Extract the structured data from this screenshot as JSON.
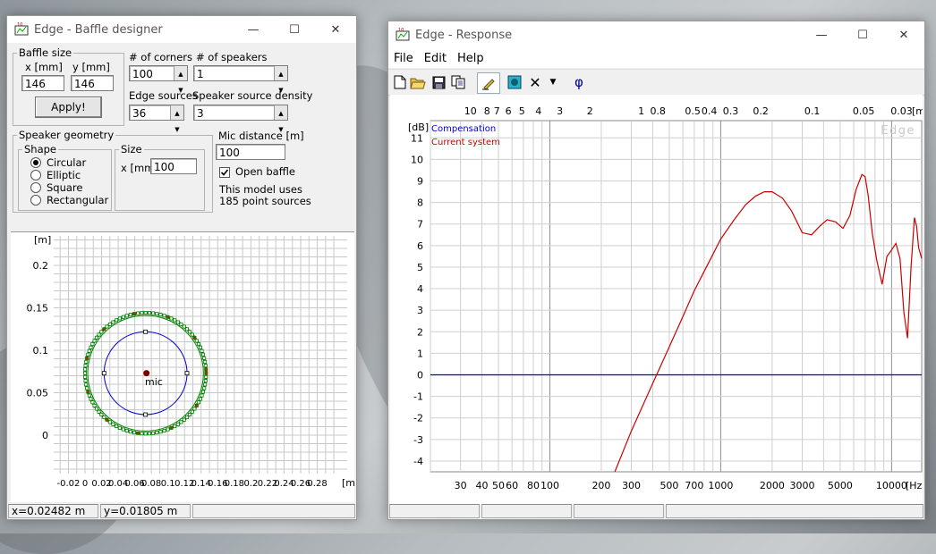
{
  "baffle_window": {
    "title": "Edge - Baffle designer",
    "controls": {
      "minimize": "—",
      "maximize": "☐",
      "close": "✕"
    },
    "baffle_size": {
      "group_label": "Baffle size",
      "x_label": "x [mm]",
      "y_label": "y [mm]",
      "x_value": "146",
      "y_value": "146",
      "apply_label": "Apply!"
    },
    "corners": {
      "label": "# of corners",
      "value": "100"
    },
    "speakers": {
      "label": "# of speakers",
      "value": "1"
    },
    "edge_sources": {
      "label": "Edge sources",
      "value": "36"
    },
    "speaker_density": {
      "label": "Speaker source density",
      "value": "3"
    },
    "speaker_geometry": {
      "group_label": "Speaker geometry",
      "shape_label": "Shape",
      "options": [
        "Circular",
        "Elliptic",
        "Square",
        "Rectangular"
      ],
      "selected": "Circular",
      "size_label": "Size",
      "size_x_label": "x [mm]",
      "size_x_value": "100"
    },
    "mic_distance": {
      "label": "Mic distance [m]",
      "value": "100"
    },
    "open_baffle": {
      "label": "Open baffle",
      "checked": true
    },
    "model_info": {
      "line1": "This model uses",
      "line2": "185 point sources"
    },
    "plot": {
      "y_unit": "[m]",
      "x_unit": "[m]",
      "y_ticks": [
        "0.2",
        "0.15",
        "0.1",
        "0.05",
        "0"
      ],
      "x_ticks": [
        "-0.02",
        "0",
        "0.02",
        "0.04",
        "0.06",
        "0.08",
        "0.1",
        "0.12",
        "0.14",
        "0.16",
        "0.18",
        "0.2",
        "0.22",
        "0.24",
        "0.26",
        "0.28"
      ],
      "mic_label": "mic",
      "baffle_color": "#008000",
      "speaker_color": "#0000cc",
      "mic_color": "#800000"
    },
    "status": {
      "x": "x=0.02482 m",
      "y": "y=0.01805 m"
    }
  },
  "response_window": {
    "title": "Edge - Response",
    "controls": {
      "minimize": "—",
      "maximize": "☐",
      "close": "✕"
    },
    "menu": [
      "File",
      "Edit",
      "Help"
    ],
    "toolbar_icons": [
      "new-file-icon",
      "open-folder-icon",
      "save-icon",
      "copy-icon",
      "pencil-icon",
      "speaker-icon",
      "delete-icon",
      "dropdown-arrow-icon",
      "phase-icon"
    ],
    "toolbar_phi": "φ",
    "chart": {
      "y_unit": "[dB]",
      "x_unit": "[Hz]",
      "top_unit": "[m]",
      "watermark": "Edge",
      "legend": [
        {
          "name": "Compensation",
          "color": "#0000cc"
        },
        {
          "name": "Current system",
          "color": "#cc0000"
        }
      ],
      "y_ticks": [
        "11",
        "10",
        "9",
        "8",
        "7",
        "6",
        "5",
        "4",
        "3",
        "2",
        "1",
        "0",
        "-1",
        "-2",
        "-3",
        "-4"
      ],
      "x_ticks": [
        "30",
        "40",
        "50",
        "60",
        "80",
        "100",
        "200",
        "300",
        "500",
        "700",
        "1000",
        "2000",
        "3000",
        "5000",
        "10000"
      ],
      "top_ticks": [
        "10",
        "8",
        "7",
        "6",
        "5",
        "4",
        "3",
        "2",
        "1",
        "0.8",
        "0.5",
        "0.4",
        "0.3",
        "0.2",
        "0.1",
        "0.05",
        "0.03"
      ]
    }
  },
  "chart_data": {
    "type": "line",
    "xlabel": "[Hz]",
    "ylabel": "[dB]",
    "xscale": "log",
    "xlim": [
      20,
      15000
    ],
    "ylim": [
      -4.5,
      11.8
    ],
    "grid": true,
    "legend_position": "top-left",
    "series": [
      {
        "name": "Compensation",
        "color": "#0000cc",
        "x": [
          20,
          15000
        ],
        "y": [
          0,
          0
        ]
      },
      {
        "name": "Current system",
        "color": "#cc0000",
        "x": [
          240,
          300,
          400,
          500,
          600,
          700,
          800,
          1000,
          1200,
          1400,
          1600,
          1800,
          2000,
          2300,
          2600,
          3000,
          3400,
          3800,
          4200,
          4700,
          5200,
          5700,
          6200,
          6700,
          7000,
          7300,
          7700,
          8200,
          8800,
          9400,
          10000,
          10600,
          11200,
          11800,
          12400,
          13000,
          13600,
          14000,
          14400,
          15000
        ],
        "y": [
          -4.5,
          -2.6,
          -0.4,
          1.3,
          2.7,
          3.9,
          4.8,
          6.3,
          7.2,
          7.9,
          8.3,
          8.5,
          8.5,
          8.2,
          7.6,
          6.6,
          6.5,
          6.9,
          7.2,
          7.1,
          6.8,
          7.4,
          8.6,
          9.3,
          9.2,
          8.3,
          6.6,
          5.3,
          4.2,
          5.5,
          5.8,
          6.1,
          5.4,
          2.9,
          1.7,
          5.0,
          7.3,
          6.9,
          5.9,
          5.4
        ]
      }
    ]
  }
}
